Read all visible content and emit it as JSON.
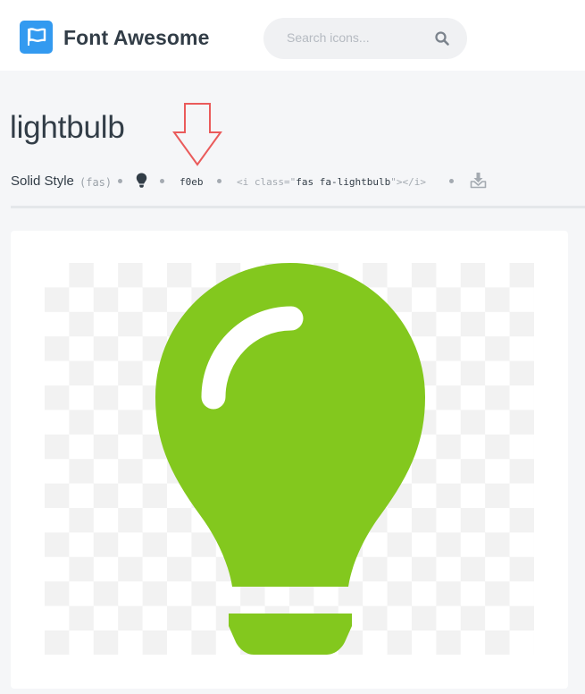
{
  "header": {
    "brand": "Font Awesome",
    "search_placeholder": "Search icons..."
  },
  "icon": {
    "name": "lightbulb",
    "style_name": "Solid Style",
    "style_prefix": "(fas)",
    "unicode": "f0eb",
    "snippet_open": "<i class=\"",
    "snippet_class": "fas fa-lightbulb",
    "snippet_close": "\"></i>",
    "color": "#83c81e"
  },
  "icons": {
    "logo": "flag-icon",
    "search": "search-icon",
    "glyph": "lightbulb-icon",
    "download": "download-icon",
    "annotation": "arrow-down-icon"
  }
}
